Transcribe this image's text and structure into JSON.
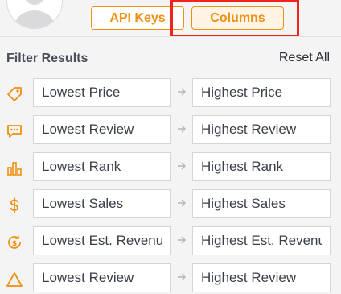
{
  "header": {
    "api_keys_label": "API Keys",
    "columns_label": "Columns"
  },
  "filter": {
    "title": "Filter Results",
    "reset_label": "Reset All",
    "rows": [
      {
        "icon": "price-tag-icon",
        "min_placeholder": "Lowest Price",
        "max_placeholder": "Highest Price"
      },
      {
        "icon": "review-chat-icon",
        "min_placeholder": "Lowest Review",
        "max_placeholder": "Highest Review"
      },
      {
        "icon": "rank-bar-chart-icon",
        "min_placeholder": "Lowest Rank",
        "max_placeholder": "Highest Rank"
      },
      {
        "icon": "dollar-sign-icon",
        "min_placeholder": "Lowest Sales",
        "max_placeholder": "Highest Sales"
      },
      {
        "icon": "revenue-cycle-icon",
        "min_placeholder": "Lowest Est. Revenue",
        "max_placeholder": "Highest Est. Revenue"
      },
      {
        "icon": "warning-triangle-icon",
        "min_placeholder": "Lowest Review",
        "max_placeholder": "Highest Review"
      }
    ]
  },
  "colors": {
    "accent": "#f0900f",
    "highlight": "#f2231b"
  }
}
